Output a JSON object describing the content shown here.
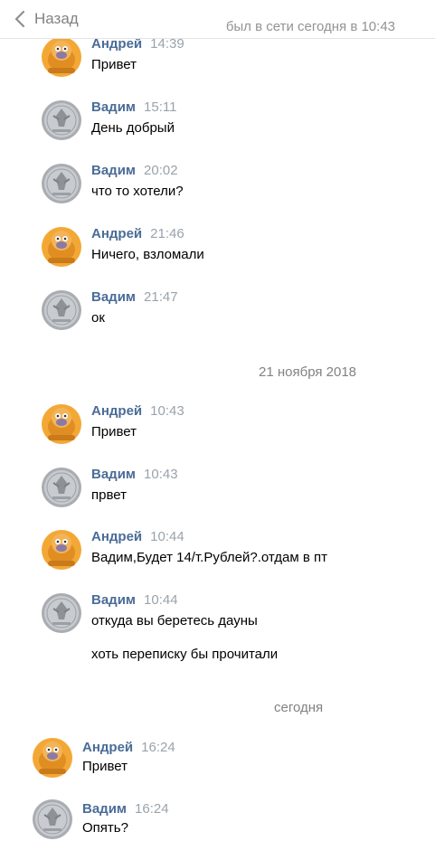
{
  "header": {
    "back_label": "Назад",
    "status": "был в сети сегодня в 10:43"
  },
  "dates": [
    "21 ноября 2018",
    "сегодня"
  ],
  "messages": [
    {
      "author": "Андрей",
      "time": "14:39",
      "lines": [
        "Привет"
      ]
    },
    {
      "author": "Вадим",
      "time": "15:11",
      "lines": [
        "День добрый"
      ]
    },
    {
      "author": "Вадим",
      "time": "20:02",
      "lines": [
        "что то хотели?"
      ]
    },
    {
      "author": "Андрей",
      "time": "21:46",
      "lines": [
        "Ничего, взломали"
      ]
    },
    {
      "author": "Вадим",
      "time": "21:47",
      "lines": [
        "ок"
      ]
    },
    {
      "author": "Андрей",
      "time": "10:43",
      "lines": [
        "Привет"
      ]
    },
    {
      "author": "Вадим",
      "time": "10:43",
      "lines": [
        "првет"
      ]
    },
    {
      "author": "Андрей",
      "time": "10:44",
      "lines": [
        "Вадим,Будет 14/т.Рублей?.отдам в пт"
      ]
    },
    {
      "author": "Вадим",
      "time": "10:44",
      "lines": [
        "откуда вы беретесь дауны",
        "хоть переписку бы прочитали"
      ]
    },
    {
      "author": "Андрей",
      "time": "16:24",
      "lines": [
        "Привет"
      ]
    },
    {
      "author": "Вадим",
      "time": "16:24",
      "lines": [
        "Опять?"
      ]
    }
  ],
  "avatars": {
    "andrey": {
      "icon": "cartoon-character-icon",
      "color": "#f0a030"
    },
    "vadim": {
      "icon": "coin-icon",
      "color": "#b9bcc0"
    }
  },
  "colors": {
    "author_name": "#4a6c97",
    "time": "#9aa3ab",
    "header_text": "#828282"
  }
}
